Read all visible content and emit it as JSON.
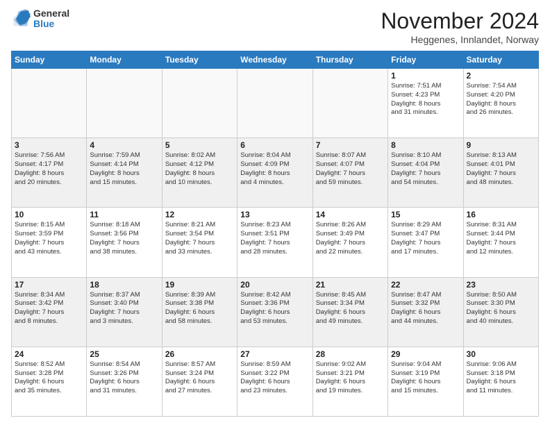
{
  "logo": {
    "general": "General",
    "blue": "Blue"
  },
  "title": "November 2024",
  "subtitle": "Heggenes, Innlandet, Norway",
  "header_days": [
    "Sunday",
    "Monday",
    "Tuesday",
    "Wednesday",
    "Thursday",
    "Friday",
    "Saturday"
  ],
  "weeks": [
    [
      {
        "day": "",
        "info": ""
      },
      {
        "day": "",
        "info": ""
      },
      {
        "day": "",
        "info": ""
      },
      {
        "day": "",
        "info": ""
      },
      {
        "day": "",
        "info": ""
      },
      {
        "day": "1",
        "info": "Sunrise: 7:51 AM\nSunset: 4:23 PM\nDaylight: 8 hours\nand 31 minutes."
      },
      {
        "day": "2",
        "info": "Sunrise: 7:54 AM\nSunset: 4:20 PM\nDaylight: 8 hours\nand 26 minutes."
      }
    ],
    [
      {
        "day": "3",
        "info": "Sunrise: 7:56 AM\nSunset: 4:17 PM\nDaylight: 8 hours\nand 20 minutes."
      },
      {
        "day": "4",
        "info": "Sunrise: 7:59 AM\nSunset: 4:14 PM\nDaylight: 8 hours\nand 15 minutes."
      },
      {
        "day": "5",
        "info": "Sunrise: 8:02 AM\nSunset: 4:12 PM\nDaylight: 8 hours\nand 10 minutes."
      },
      {
        "day": "6",
        "info": "Sunrise: 8:04 AM\nSunset: 4:09 PM\nDaylight: 8 hours\nand 4 minutes."
      },
      {
        "day": "7",
        "info": "Sunrise: 8:07 AM\nSunset: 4:07 PM\nDaylight: 7 hours\nand 59 minutes."
      },
      {
        "day": "8",
        "info": "Sunrise: 8:10 AM\nSunset: 4:04 PM\nDaylight: 7 hours\nand 54 minutes."
      },
      {
        "day": "9",
        "info": "Sunrise: 8:13 AM\nSunset: 4:01 PM\nDaylight: 7 hours\nand 48 minutes."
      }
    ],
    [
      {
        "day": "10",
        "info": "Sunrise: 8:15 AM\nSunset: 3:59 PM\nDaylight: 7 hours\nand 43 minutes."
      },
      {
        "day": "11",
        "info": "Sunrise: 8:18 AM\nSunset: 3:56 PM\nDaylight: 7 hours\nand 38 minutes."
      },
      {
        "day": "12",
        "info": "Sunrise: 8:21 AM\nSunset: 3:54 PM\nDaylight: 7 hours\nand 33 minutes."
      },
      {
        "day": "13",
        "info": "Sunrise: 8:23 AM\nSunset: 3:51 PM\nDaylight: 7 hours\nand 28 minutes."
      },
      {
        "day": "14",
        "info": "Sunrise: 8:26 AM\nSunset: 3:49 PM\nDaylight: 7 hours\nand 22 minutes."
      },
      {
        "day": "15",
        "info": "Sunrise: 8:29 AM\nSunset: 3:47 PM\nDaylight: 7 hours\nand 17 minutes."
      },
      {
        "day": "16",
        "info": "Sunrise: 8:31 AM\nSunset: 3:44 PM\nDaylight: 7 hours\nand 12 minutes."
      }
    ],
    [
      {
        "day": "17",
        "info": "Sunrise: 8:34 AM\nSunset: 3:42 PM\nDaylight: 7 hours\nand 8 minutes."
      },
      {
        "day": "18",
        "info": "Sunrise: 8:37 AM\nSunset: 3:40 PM\nDaylight: 7 hours\nand 3 minutes."
      },
      {
        "day": "19",
        "info": "Sunrise: 8:39 AM\nSunset: 3:38 PM\nDaylight: 6 hours\nand 58 minutes."
      },
      {
        "day": "20",
        "info": "Sunrise: 8:42 AM\nSunset: 3:36 PM\nDaylight: 6 hours\nand 53 minutes."
      },
      {
        "day": "21",
        "info": "Sunrise: 8:45 AM\nSunset: 3:34 PM\nDaylight: 6 hours\nand 49 minutes."
      },
      {
        "day": "22",
        "info": "Sunrise: 8:47 AM\nSunset: 3:32 PM\nDaylight: 6 hours\nand 44 minutes."
      },
      {
        "day": "23",
        "info": "Sunrise: 8:50 AM\nSunset: 3:30 PM\nDaylight: 6 hours\nand 40 minutes."
      }
    ],
    [
      {
        "day": "24",
        "info": "Sunrise: 8:52 AM\nSunset: 3:28 PM\nDaylight: 6 hours\nand 35 minutes."
      },
      {
        "day": "25",
        "info": "Sunrise: 8:54 AM\nSunset: 3:26 PM\nDaylight: 6 hours\nand 31 minutes."
      },
      {
        "day": "26",
        "info": "Sunrise: 8:57 AM\nSunset: 3:24 PM\nDaylight: 6 hours\nand 27 minutes."
      },
      {
        "day": "27",
        "info": "Sunrise: 8:59 AM\nSunset: 3:22 PM\nDaylight: 6 hours\nand 23 minutes."
      },
      {
        "day": "28",
        "info": "Sunrise: 9:02 AM\nSunset: 3:21 PM\nDaylight: 6 hours\nand 19 minutes."
      },
      {
        "day": "29",
        "info": "Sunrise: 9:04 AM\nSunset: 3:19 PM\nDaylight: 6 hours\nand 15 minutes."
      },
      {
        "day": "30",
        "info": "Sunrise: 9:06 AM\nSunset: 3:18 PM\nDaylight: 6 hours\nand 11 minutes."
      }
    ]
  ]
}
